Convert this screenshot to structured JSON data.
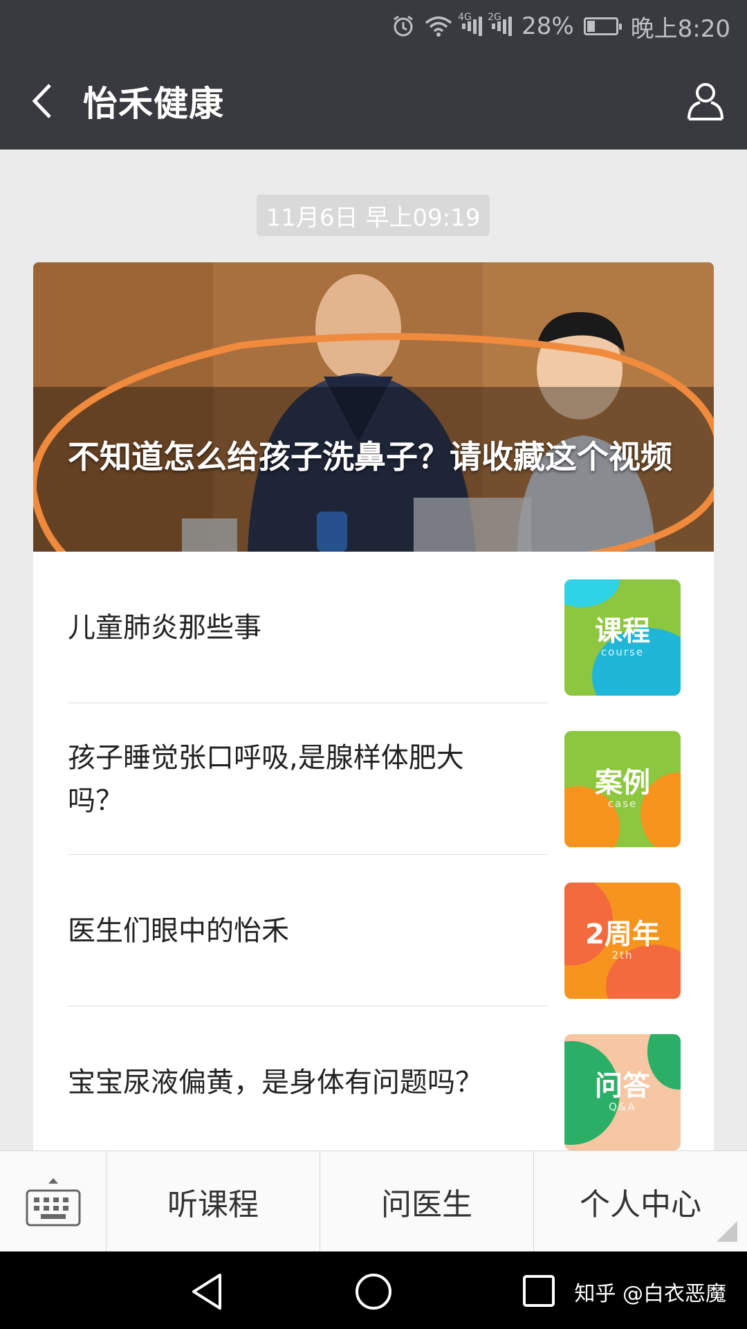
{
  "status_bar": {
    "network_1": "4G",
    "network_2": "2G",
    "battery": "28%",
    "battery_level": 0.28,
    "time": "晚上8:20"
  },
  "header": {
    "title": "怡禾健康"
  },
  "chat": {
    "timestamp": "11月6日 早上09:19",
    "cover_title": "不知道怎么给孩子洗鼻子？请收藏这个视频",
    "articles": [
      {
        "title": "儿童肺炎那些事",
        "thumb_main": "课程",
        "thumb_sub": "course"
      },
      {
        "title": "孩子睡觉张口呼吸,是腺样体肥大吗？",
        "thumb_main": "案例",
        "thumb_sub": "case"
      },
      {
        "title": "医生们眼中的怡禾",
        "thumb_main": "2周年",
        "thumb_sub": "2th"
      },
      {
        "title": "宝宝尿液偏黄，是身体有问题吗？",
        "thumb_main": "问答",
        "thumb_sub": "Q&A"
      }
    ]
  },
  "menu": {
    "items": [
      "听课程",
      "问医生",
      "个人中心"
    ]
  },
  "nav": {
    "watermark": "知乎 @白衣恶魔"
  },
  "colors": {
    "header_bg": "#393a3f",
    "annotation": "#f08a3c",
    "thumb_course": "#8dc63f",
    "thumb_case": "#8dc63f",
    "thumb_anniv": "#f7941d",
    "thumb_qa": "#f7c6a3"
  }
}
